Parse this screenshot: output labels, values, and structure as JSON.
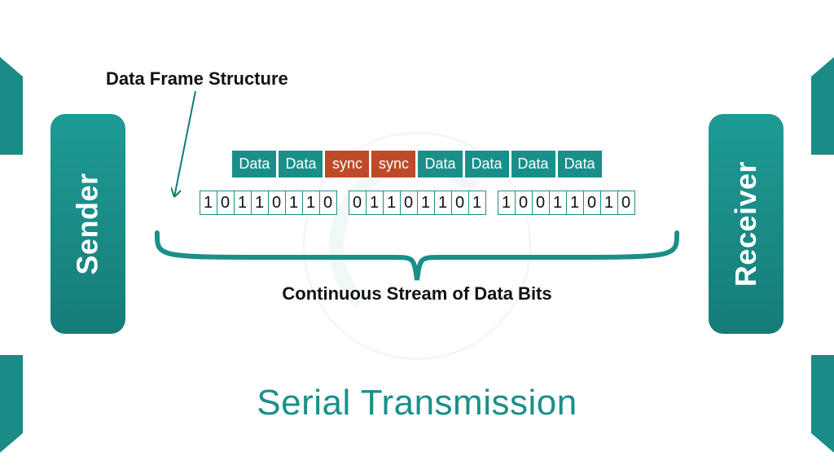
{
  "title": "Serial Transmission",
  "sender_label": "Sender",
  "receiver_label": "Receiver",
  "frame_label": "Data Frame Structure",
  "continuous_label": "Continuous Stream of Data Bits",
  "frame_cells": [
    {
      "label": "Data",
      "kind": "data"
    },
    {
      "label": "Data",
      "kind": "data"
    },
    {
      "label": "sync",
      "kind": "sync"
    },
    {
      "label": "sync",
      "kind": "sync"
    },
    {
      "label": "Data",
      "kind": "data"
    },
    {
      "label": "Data",
      "kind": "data"
    },
    {
      "label": "Data",
      "kind": "data"
    },
    {
      "label": "Data",
      "kind": "data"
    }
  ],
  "bit_groups": [
    [
      "1",
      "0",
      "1",
      "1",
      "0",
      "1",
      "1",
      "0"
    ],
    [
      "0",
      "1",
      "1",
      "0",
      "1",
      "1",
      "0",
      "1"
    ],
    [
      "1",
      "0",
      "0",
      "1",
      "1",
      "0",
      "1",
      "0"
    ]
  ],
  "colors": {
    "teal": "#1a8f8a",
    "sync": "#bd4a28"
  }
}
